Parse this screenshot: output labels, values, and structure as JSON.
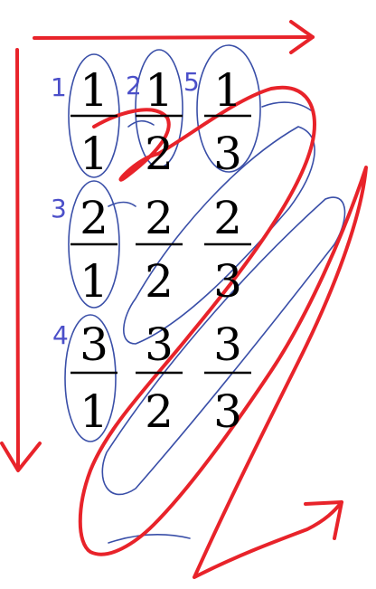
{
  "fractions": [
    {
      "num": "1",
      "den": "1"
    },
    {
      "num": "1",
      "den": "2"
    },
    {
      "num": "1",
      "den": "3"
    },
    {
      "num": "2",
      "den": "1"
    },
    {
      "num": "2",
      "den": "2"
    },
    {
      "num": "2",
      "den": "3"
    },
    {
      "num": "3",
      "den": "1"
    },
    {
      "num": "3",
      "den": "2"
    },
    {
      "num": "3",
      "den": "3"
    }
  ],
  "order_labels": [
    "1",
    "2",
    "5",
    "3",
    "4"
  ],
  "colors": {
    "ink": "#000000",
    "red": "#e8232a",
    "blue_ink": "#3a4fa8",
    "label_blue": "#4b4fc9"
  }
}
